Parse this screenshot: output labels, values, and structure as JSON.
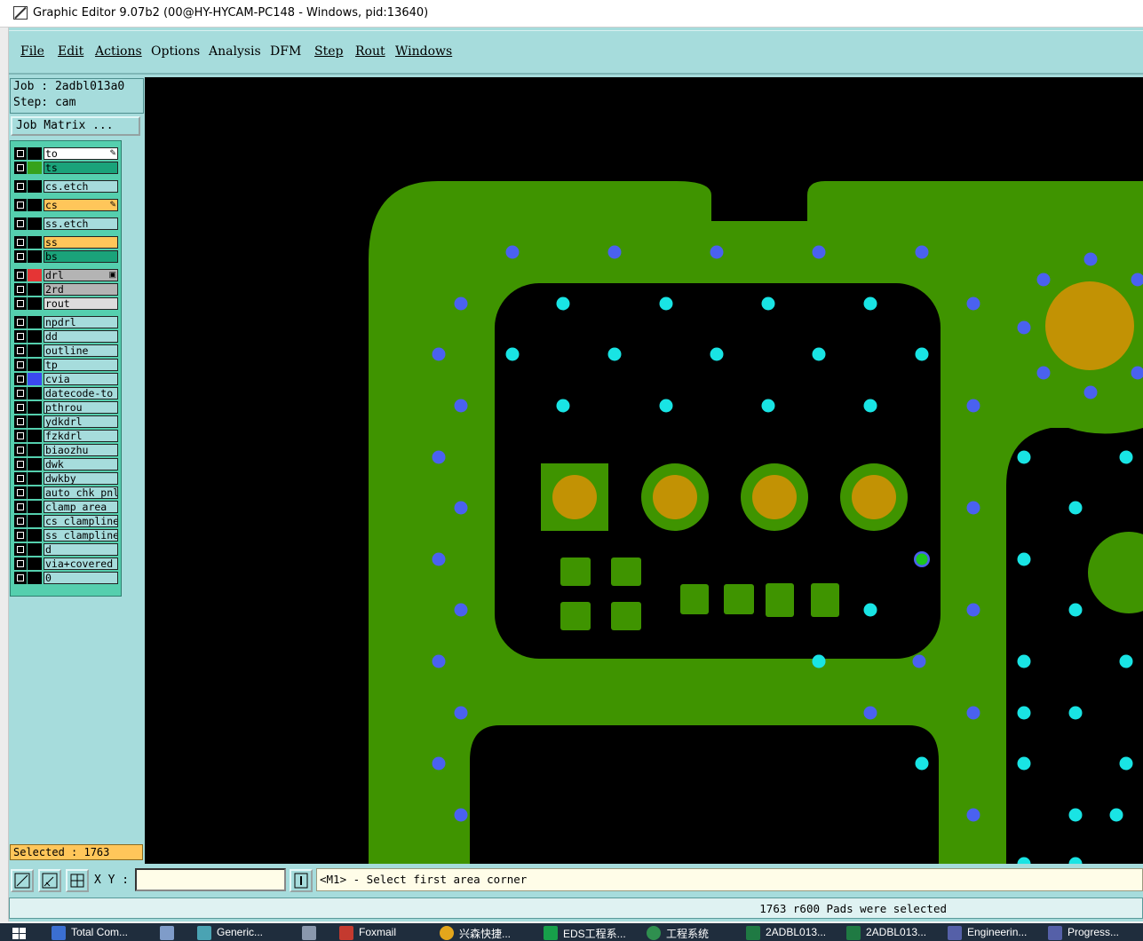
{
  "window": {
    "title": "Graphic Editor 9.07b2 (00@HY-HYCAM-PC148 - Windows, pid:13640)"
  },
  "menu": [
    "File",
    "Edit",
    "Actions",
    "Options",
    "Analysis",
    "DFM",
    "Step",
    "Rout",
    "Windows"
  ],
  "job": {
    "job_line": "Job : 2adbl013a0",
    "step_line": "Step: cam",
    "matrix_button": "Job Matrix ..."
  },
  "layers": [
    {
      "name": "to",
      "bg": "#ffffff",
      "swatch": "#000000",
      "mark": "✎"
    },
    {
      "name": "ts",
      "bg": "#1aa37a",
      "swatch": "#36a21c",
      "mark": ""
    },
    {
      "name": "cs.etch",
      "bg": "#a6dcdc",
      "swatch": "#000000",
      "mark": ""
    },
    {
      "name": "cs",
      "bg": "#ffc65a",
      "swatch": "#000000",
      "mark": "✎"
    },
    {
      "name": "ss.etch",
      "bg": "#a6dcdc",
      "swatch": "#000000",
      "mark": ""
    },
    {
      "name": "ss",
      "bg": "#ffc65a",
      "swatch": "#000000",
      "mark": ""
    },
    {
      "name": "bs",
      "bg": "#1aa37a",
      "swatch": "#000000",
      "mark": ""
    },
    {
      "name": "drl",
      "bg": "#b4b4b4",
      "swatch": "#e53535",
      "mark": "▣"
    },
    {
      "name": "2rd",
      "bg": "#b4b4b4",
      "swatch": "#000000",
      "mark": ""
    },
    {
      "name": "rout",
      "bg": "#dcdcdc",
      "swatch": "#000000",
      "mark": ""
    },
    {
      "name": "npdrl",
      "bg": "#a6dcdc",
      "swatch": "#000000",
      "mark": ""
    },
    {
      "name": "dd",
      "bg": "#a6dcdc",
      "swatch": "#000000",
      "mark": ""
    },
    {
      "name": "outline",
      "bg": "#a6dcdc",
      "swatch": "#000000",
      "mark": ""
    },
    {
      "name": "tp",
      "bg": "#a6dcdc",
      "swatch": "#000000",
      "mark": ""
    },
    {
      "name": "cvia",
      "bg": "#a6dcdc",
      "swatch": "#3b49f0",
      "mark": ""
    },
    {
      "name": "datecode-to",
      "bg": "#a6dcdc",
      "swatch": "#000000",
      "mark": ""
    },
    {
      "name": "pthrou",
      "bg": "#a6dcdc",
      "swatch": "#000000",
      "mark": ""
    },
    {
      "name": "ydkdrl",
      "bg": "#a6dcdc",
      "swatch": "#000000",
      "mark": ""
    },
    {
      "name": "fzkdrl",
      "bg": "#a6dcdc",
      "swatch": "#000000",
      "mark": ""
    },
    {
      "name": "biaozhu",
      "bg": "#a6dcdc",
      "swatch": "#000000",
      "mark": ""
    },
    {
      "name": "dwk",
      "bg": "#a6dcdc",
      "swatch": "#000000",
      "mark": ""
    },
    {
      "name": "dwkby",
      "bg": "#a6dcdc",
      "swatch": "#000000",
      "mark": ""
    },
    {
      "name": "auto_chk_pnl",
      "bg": "#a6dcdc",
      "swatch": "#000000",
      "mark": ""
    },
    {
      "name": "clamp_area",
      "bg": "#a6dcdc",
      "swatch": "#000000",
      "mark": ""
    },
    {
      "name": "cs_clampline",
      "bg": "#a6dcdc",
      "swatch": "#000000",
      "mark": ""
    },
    {
      "name": "ss_clampline",
      "bg": "#a6dcdc",
      "swatch": "#000000",
      "mark": ""
    },
    {
      "name": "d",
      "bg": "#a6dcdc",
      "swatch": "#000000",
      "mark": ""
    },
    {
      "name": "via+covered",
      "bg": "#a6dcdc",
      "swatch": "#000000",
      "mark": ""
    },
    {
      "name": "0",
      "bg": "#a6dcdc",
      "swatch": "#000000",
      "mark": ""
    }
  ],
  "selected_label": "Selected : 1763",
  "coords": {
    "label": "X Y :",
    "value": ""
  },
  "prompt": "<M1> - Select first area corner",
  "status": "1763 r600 Pads were selected",
  "colors": {
    "board": "#3f9400",
    "pad": "#c29204",
    "via_blue": "#4a61f0",
    "via_cyan": "#19e4e4",
    "panel": "#a6dcdc"
  },
  "taskbar": [
    "Total Com...",
    "Generic...",
    "Foxmail",
    "兴森快捷...",
    "EDS工程系...",
    "工程系统",
    "2ADBL013...",
    "2ADBL013...",
    "Engineerin...",
    "Progress..."
  ]
}
